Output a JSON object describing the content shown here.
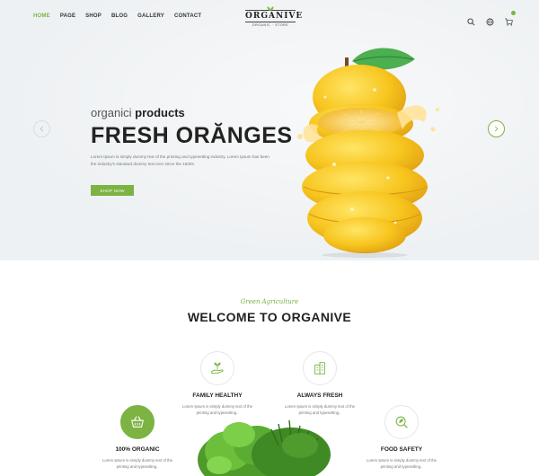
{
  "nav": {
    "items": [
      "HOME",
      "PAGE",
      "SHOP",
      "BLOG",
      "GALLERY",
      "CONTACT"
    ],
    "active": "HOME"
  },
  "logo": {
    "name": "ORGANIVE",
    "tagline": "ORGANIC · STORE"
  },
  "icons": {
    "search": "search-icon",
    "language": "globe-icon",
    "cart": "cart-icon"
  },
  "hero": {
    "subtitle_light": "organici ",
    "subtitle_bold": "products",
    "title": "FRESH ORĂNGES",
    "description": "Lorem Ipsum is simply dummy text of the printing and typesetting industry. Lorem Ipsum has been the industry's standard dummy text ever since the 1500s.",
    "button": "SHOP NOW"
  },
  "welcome": {
    "kicker": "Green Agriculture",
    "title": "WELCOME TO ORGANIVE"
  },
  "features": [
    {
      "title": "FAMILY HEALTHY",
      "desc": "Lorem Ipsum is simply dummy text of the printing and typesetting..",
      "icon": "hand-plant-icon"
    },
    {
      "title": "ALWAYS FRESH",
      "desc": "Lorem Ipsum is simply dummy text of the printing and typesetting..",
      "icon": "buildings-icon"
    },
    {
      "title": "100% ORGANIC",
      "desc": "Lorem Ipsum is simply dummy text of the printing and typesetting..",
      "icon": "basket-icon"
    },
    {
      "title": "FOOD SAFETY",
      "desc": "Lorem Ipsum is simply dummy text of the printing and typesetting..",
      "icon": "leaf-search-icon"
    }
  ],
  "colors": {
    "accent": "#7cb342",
    "dark": "#222222",
    "hero_bg": "#eef1f3",
    "orange": "#f7c51e"
  }
}
